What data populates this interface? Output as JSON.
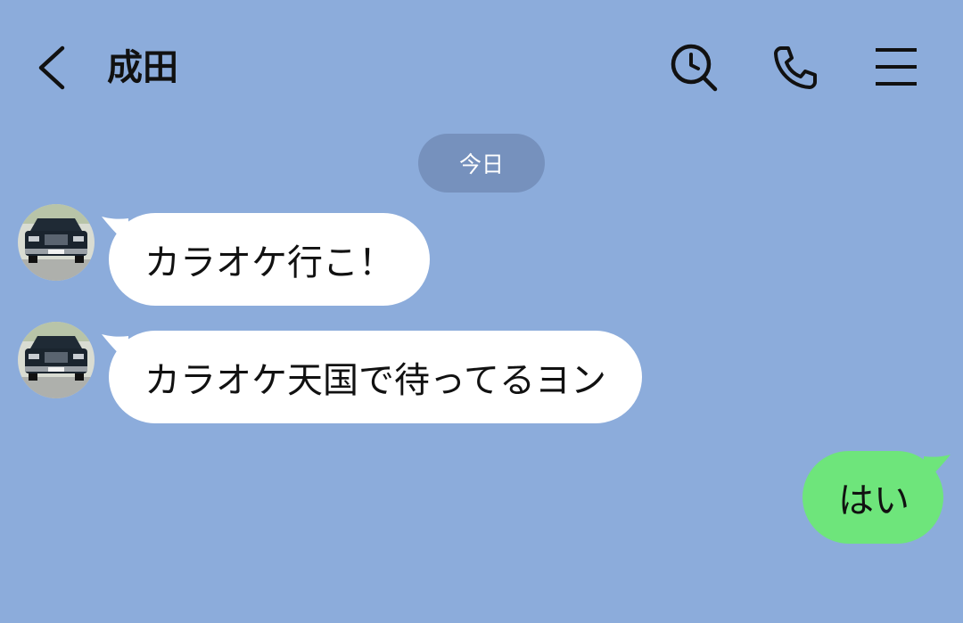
{
  "header": {
    "contact_name": "成田",
    "icons": {
      "back": "chevron-left-icon",
      "search": "search-clock-icon",
      "call": "phone-icon",
      "menu": "menu-icon"
    }
  },
  "date_separator": "今日",
  "messages": [
    {
      "sender": "contact",
      "text": "カラオケ行こ！"
    },
    {
      "sender": "contact",
      "text": "カラオケ天国で待ってるヨン"
    },
    {
      "sender": "me",
      "text": "はい"
    }
  ],
  "colors": {
    "background": "#8CACDB",
    "date_pill": "#7691BD",
    "incoming_bubble": "#FFFFFF",
    "outgoing_bubble": "#6EE57B",
    "icon": "#111111"
  }
}
